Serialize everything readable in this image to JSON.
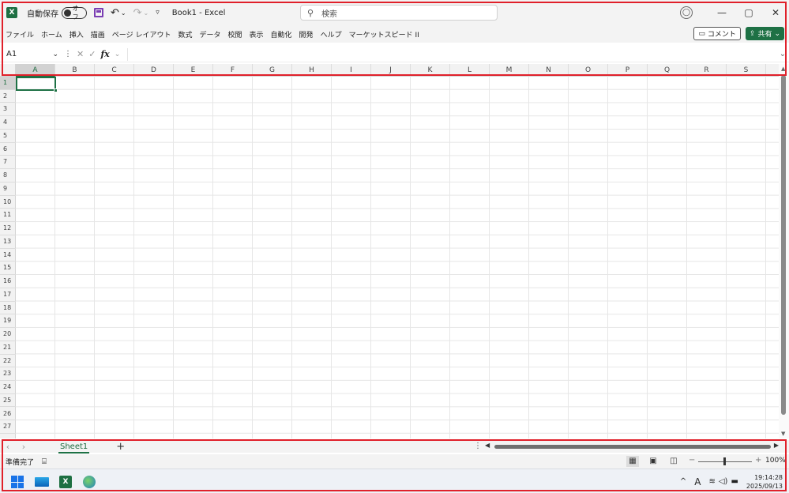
{
  "titlebar": {
    "autosave_label": "自動保存",
    "autosave_state": "オフ",
    "doc_title": "Book1  -  Excel",
    "search_placeholder": "検索",
    "minimize": "—",
    "restore": "▢",
    "close": "✕"
  },
  "ribbon": {
    "tabs": [
      "ファイル",
      "ホーム",
      "挿入",
      "描画",
      "ページ レイアウト",
      "数式",
      "データ",
      "校閲",
      "表示",
      "自動化",
      "開発",
      "ヘルプ",
      "マーケットスピード II"
    ],
    "comment_label": "コメント",
    "share_label": "共有"
  },
  "formula_bar": {
    "name_box": "A1",
    "formula": ""
  },
  "grid": {
    "columns": [
      "A",
      "B",
      "C",
      "D",
      "E",
      "F",
      "G",
      "H",
      "I",
      "J",
      "K",
      "L",
      "M",
      "N",
      "O",
      "P",
      "Q",
      "R",
      "S"
    ],
    "rows": [
      "1",
      "2",
      "3",
      "4",
      "5",
      "6",
      "7",
      "8",
      "9",
      "10",
      "11",
      "12",
      "13",
      "14",
      "15",
      "16",
      "17",
      "18",
      "19",
      "20",
      "21",
      "22",
      "23",
      "24",
      "25",
      "26",
      "27"
    ],
    "active_cell": "A1"
  },
  "sheets": {
    "tabs": [
      "Sheet1"
    ],
    "add_label": "+"
  },
  "statusbar": {
    "status": "準備完了",
    "zoom_minus": "−",
    "zoom_plus": "+",
    "zoom_percent": "100%"
  },
  "taskbar": {
    "time": "19:14:28",
    "date": "2025/09/13",
    "ime": "A"
  }
}
